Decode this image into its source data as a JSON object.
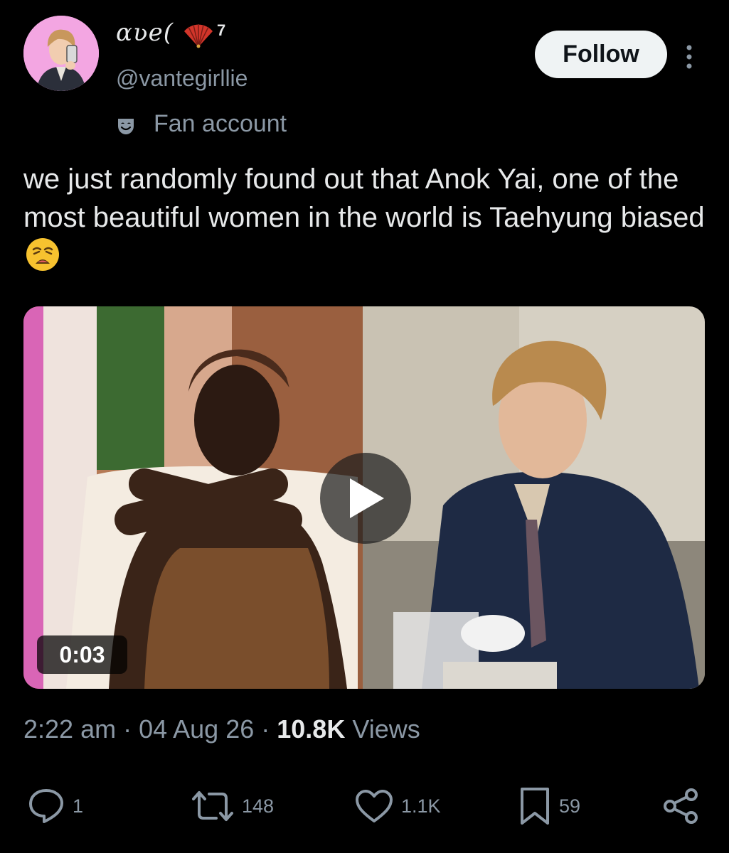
{
  "author": {
    "display_name": "ɑʋe(",
    "name_suffix": "7",
    "handle": "@vantegirllie",
    "label": "Fan account",
    "avatar_icon": "avatar-photo"
  },
  "follow_label": "Follow",
  "post": {
    "text": "we just randomly found out that Anok Yai, one of the most beautiful women in the world is Taehyung biased",
    "emoji": "weary-face-emoji"
  },
  "media": {
    "duration": "0:03",
    "play_icon": "play-icon"
  },
  "meta": {
    "time": "2:22 am",
    "sep1": " · ",
    "date": "04 Aug 26",
    "sep2": " · ",
    "views_count": "10.8K",
    "views_label": " Views"
  },
  "actions": {
    "replies": "1",
    "reposts": "148",
    "likes": "1.1K",
    "bookmarks": "59"
  },
  "colors": {
    "background": "#000000",
    "primary_text": "#e7e9ea",
    "secondary_text": "#8b98a5",
    "button_bg": "#eff3f4",
    "avatar_bg": "#f3a6e2"
  }
}
